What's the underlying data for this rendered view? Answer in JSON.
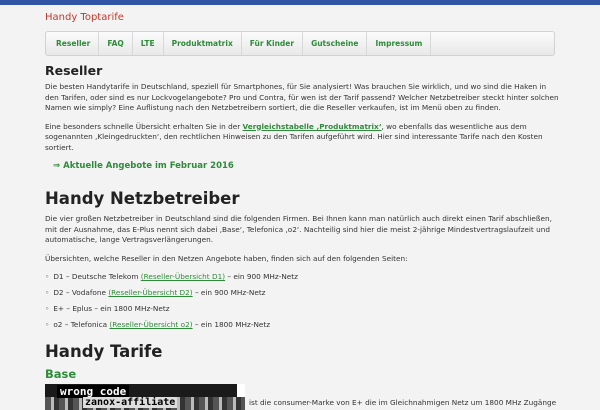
{
  "site": {
    "title": "Handy Toptarife"
  },
  "nav": {
    "items": [
      "Reseller",
      "FAQ",
      "LTE",
      "Produktmatrix",
      "Für Kinder",
      "Gutscheine",
      "Impressum"
    ]
  },
  "reseller": {
    "heading": "Reseller",
    "intro": "Die besten Handytarife in Deutschland, speziell für Smartphones, für Sie analysiert! Was brauchen Sie wirklich, und wo sind die Haken in den Tarifen, oder sind es nur Lockvogelangebote? Pro und Contra, für wen ist der Tarif passend? Welcher Netzbetreiber steckt hinter solchen Namen wie simply? Eine Auflistung nach den Netzbetreibern sortiert, die die Reseller verkaufen, ist im Menü oben zu finden.",
    "p2_before": "Eine besonders schnelle Übersicht erhalten Sie in der ",
    "p2_link": "Vergleichstabelle ‚Produktmatrix‘",
    "p2_after": ", wo ebenfalls das wesentliche aus dem sogenannten ‚Kleingedruckten‘, den rechtlichen Hinweisen zu den Tarifen aufgeführt wird. Hier sind interessante Tarife nach den Kosten sortiert.",
    "cta_arrow": "⇒",
    "cta_label": "Aktuelle Angebote im Februar 2016"
  },
  "netzbetreiber": {
    "heading": "Handy Netzbetreiber",
    "p1": "Die vier großen Netzbetreiber in Deutschland sind die folgenden Firmen. Bei Ihnen kann man natürlich auch direkt einen Tarif abschließen, mit der Ausnahme, das E-Plus nennt sich dabei ‚Base‘, Telefonica ‚o2‘. Nachteilig sind hier die meist 2-jährige Mindestvertragslaufzeit und automatische, lange Vertragsverlängerungen.",
    "p2": "Übersichten, welche Reseller in den Netzen Angebote haben, finden sich auf den folgenden Seiten:",
    "operators": [
      {
        "bullet": "◦",
        "before": "D1 – Deutsche Telekom ",
        "link": "(Reseller-Übersicht D1)",
        "after": " – ein 900 MHz-Netz"
      },
      {
        "bullet": "◦",
        "before": "D2 – Vodafone ",
        "link": "(Reseller-Übersicht D2)",
        "after": " – ein 900 MHz-Netz"
      },
      {
        "bullet": "◦",
        "before": "E+ – Eplus – ein 1800 MHz-Netz",
        "link": "",
        "after": ""
      },
      {
        "bullet": "◦",
        "before": "o2 – Telefonica ",
        "link": "(Reseller-Übersicht o2)",
        "after": " – ein 1800 MHz-Netz"
      }
    ]
  },
  "tarife": {
    "heading": "Handy Tarife",
    "base_heading": "Base",
    "banner_line1": "wrong code",
    "banner_line2": "zanox-affiliate",
    "base_text": "ist die consumer-Marke von E+ die im Gleichnahmigen Netz um 1800 MHz Zugänge"
  },
  "colors": {
    "accent_green": "#2e8b3a",
    "title_red": "#c0392b",
    "topbar_blue": "#2f55a4"
  }
}
